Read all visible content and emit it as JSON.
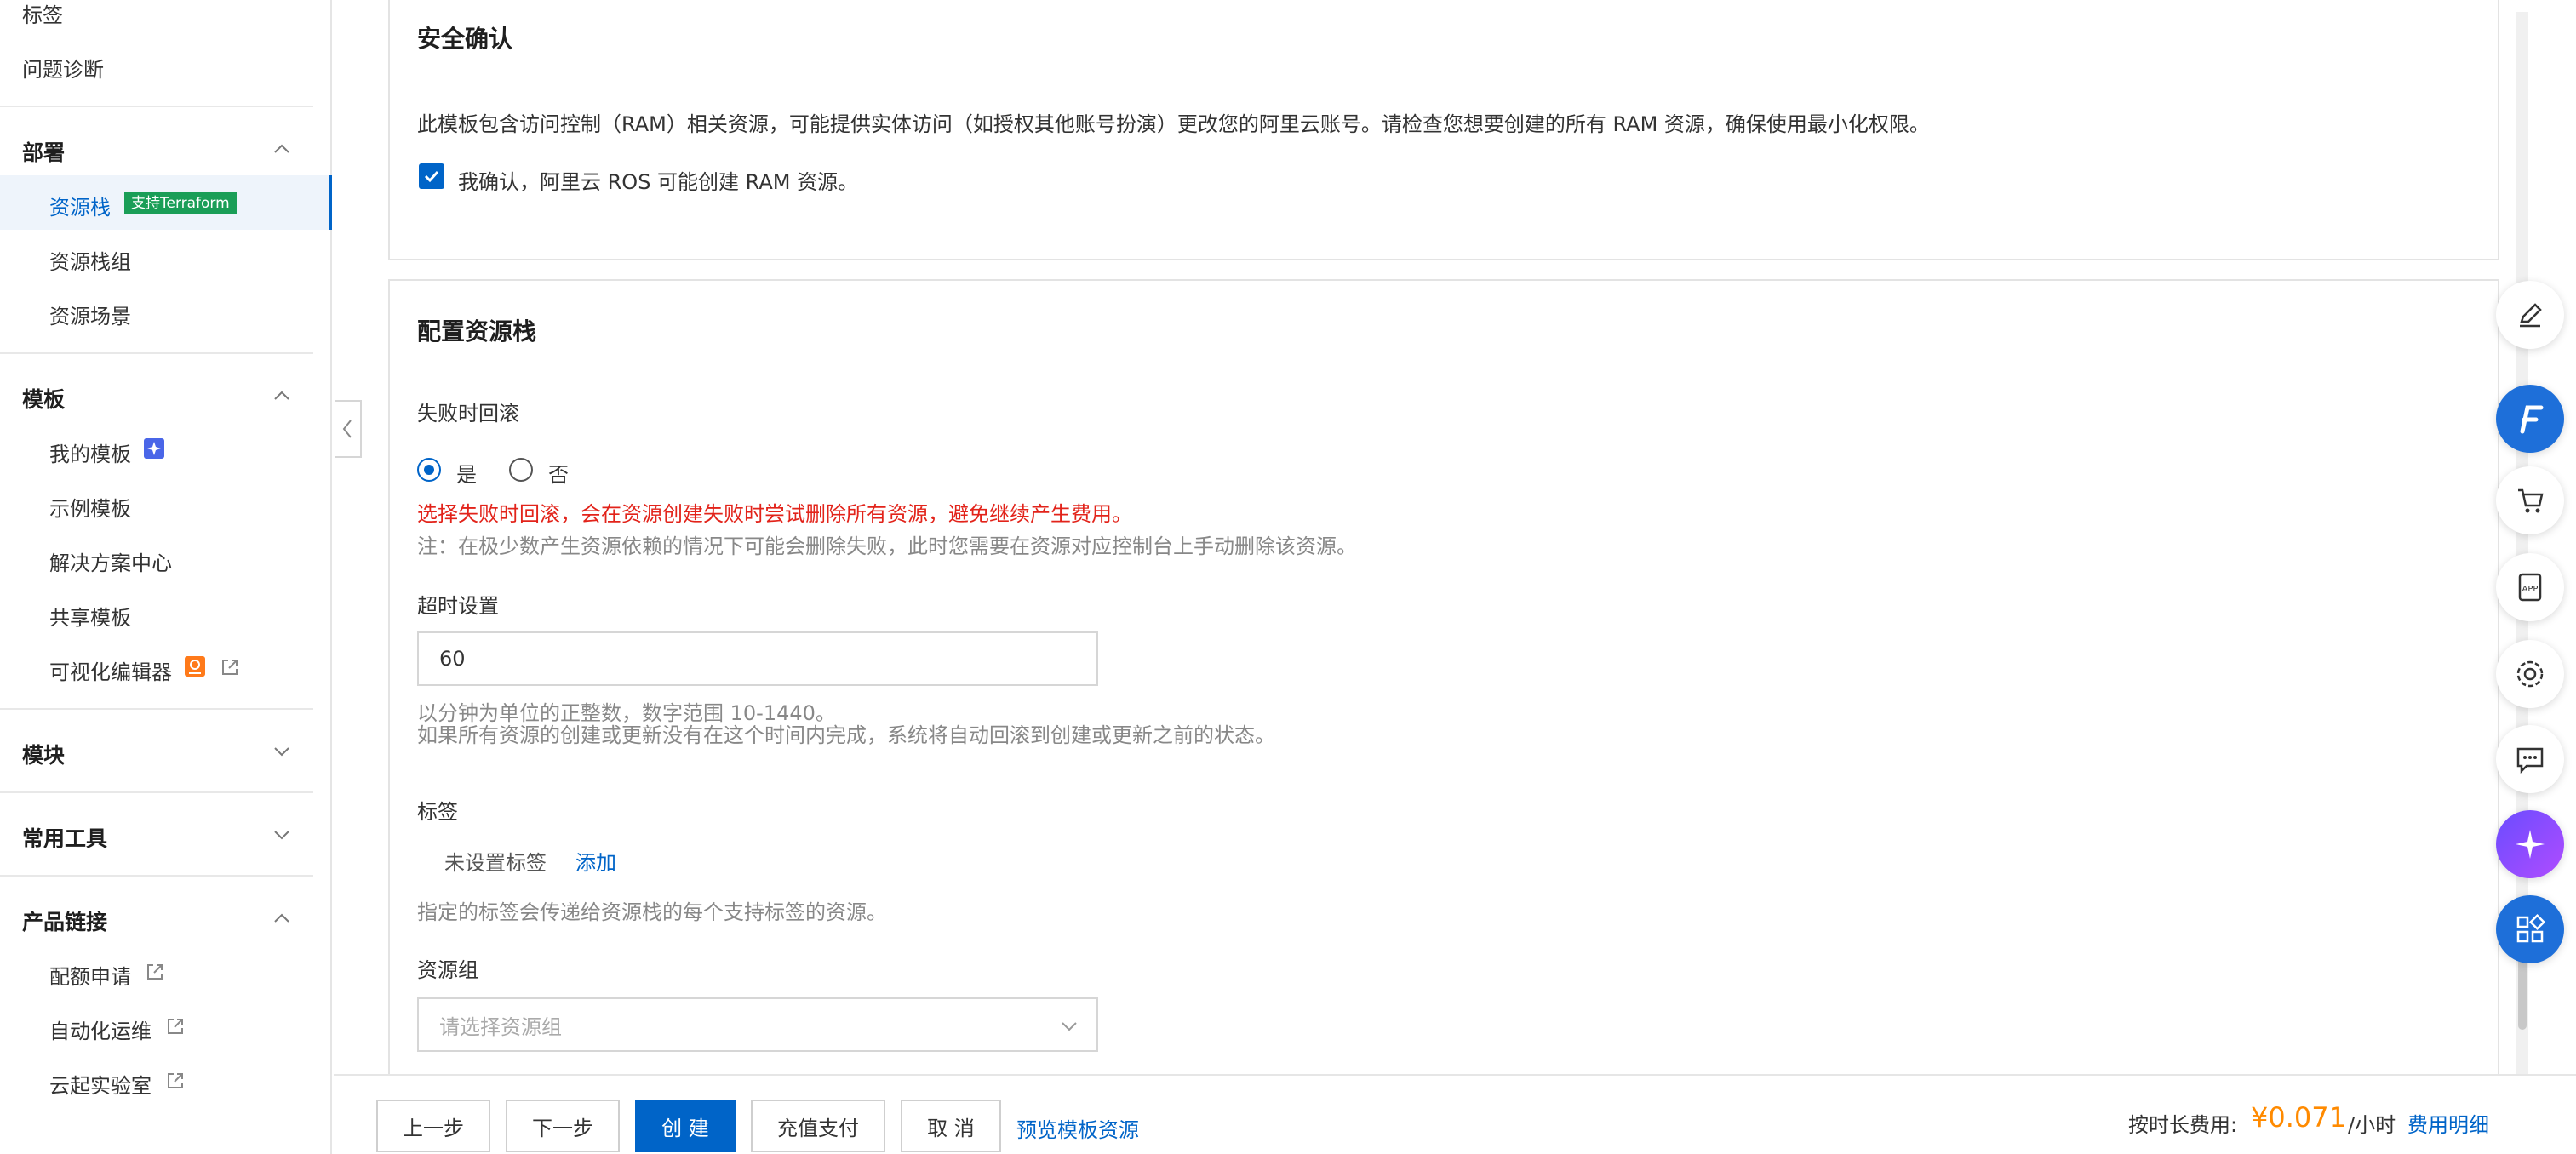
{
  "sidebar": {
    "top_items": [
      "标签",
      "问题诊断"
    ],
    "groups": {
      "deploy": {
        "label": "部署",
        "items": [
          "资源栈",
          "资源栈组",
          "资源场景"
        ],
        "tag": "支持Terraform"
      },
      "template": {
        "label": "模板",
        "items": [
          "我的模板",
          "示例模板",
          "解决方案中心",
          "共享模板",
          "可视化编辑器"
        ]
      },
      "module": {
        "label": "模块"
      },
      "tools": {
        "label": "常用工具"
      },
      "links": {
        "label": "产品链接",
        "items": [
          "配额申请",
          "自动化运维",
          "云起实验室"
        ]
      }
    }
  },
  "security": {
    "title": "安全确认",
    "description": "此模板包含访问控制（RAM）相关资源，可能提供实体访问（如授权其他账号扮演）更改您的阿里云账号。请检查您想要创建的所有 RAM 资源，确保使用最小化权限。",
    "confirm_label": "我确认，阿里云 ROS 可能创建 RAM 资源。",
    "confirmed": true
  },
  "config": {
    "title": "配置资源栈",
    "rollback": {
      "label": "失败时回滚",
      "options": [
        "是",
        "否"
      ],
      "selected": "是",
      "warning": "选择失败时回滚，会在资源创建失败时尝试删除所有资源，避免继续产生费用。",
      "note": "注：在极少数产生资源依赖的情况下可能会删除失败，此时您需要在资源对应控制台上手动删除该资源。"
    },
    "timeout": {
      "label": "超时设置",
      "value": "60",
      "help1": "以分钟为单位的正整数，数字范围 10-1440。",
      "help2": "如果所有资源的创建或更新没有在这个时间内完成，系统将自动回滚到创建或更新之前的状态。"
    },
    "tags": {
      "label": "标签",
      "empty_text": "未设置标签",
      "add_link": "添加",
      "help": "指定的标签会传递给资源栈的每个支持标签的资源。"
    },
    "resource_group": {
      "label": "资源组",
      "placeholder": "请选择资源组"
    }
  },
  "footer": {
    "prev": "上一步",
    "next": "下一步",
    "create": "创 建",
    "recharge": "充值支付",
    "cancel": "取 消",
    "preview": "预览模板资源",
    "fee_label": "按时长费用:",
    "fee_value": "¥0.071",
    "fee_unit": "/小时",
    "fee_detail": "费用明细"
  },
  "colors": {
    "primary": "#0064c8",
    "warning": "#e2231a",
    "price": "#ff8a00",
    "tag_green": "#1a9e57"
  },
  "float_tools": [
    "edit-icon",
    "assistant-f-icon",
    "cart-icon",
    "app-icon",
    "settings-icon",
    "feedback-icon",
    "ai-star-icon",
    "apps-grid-icon"
  ]
}
